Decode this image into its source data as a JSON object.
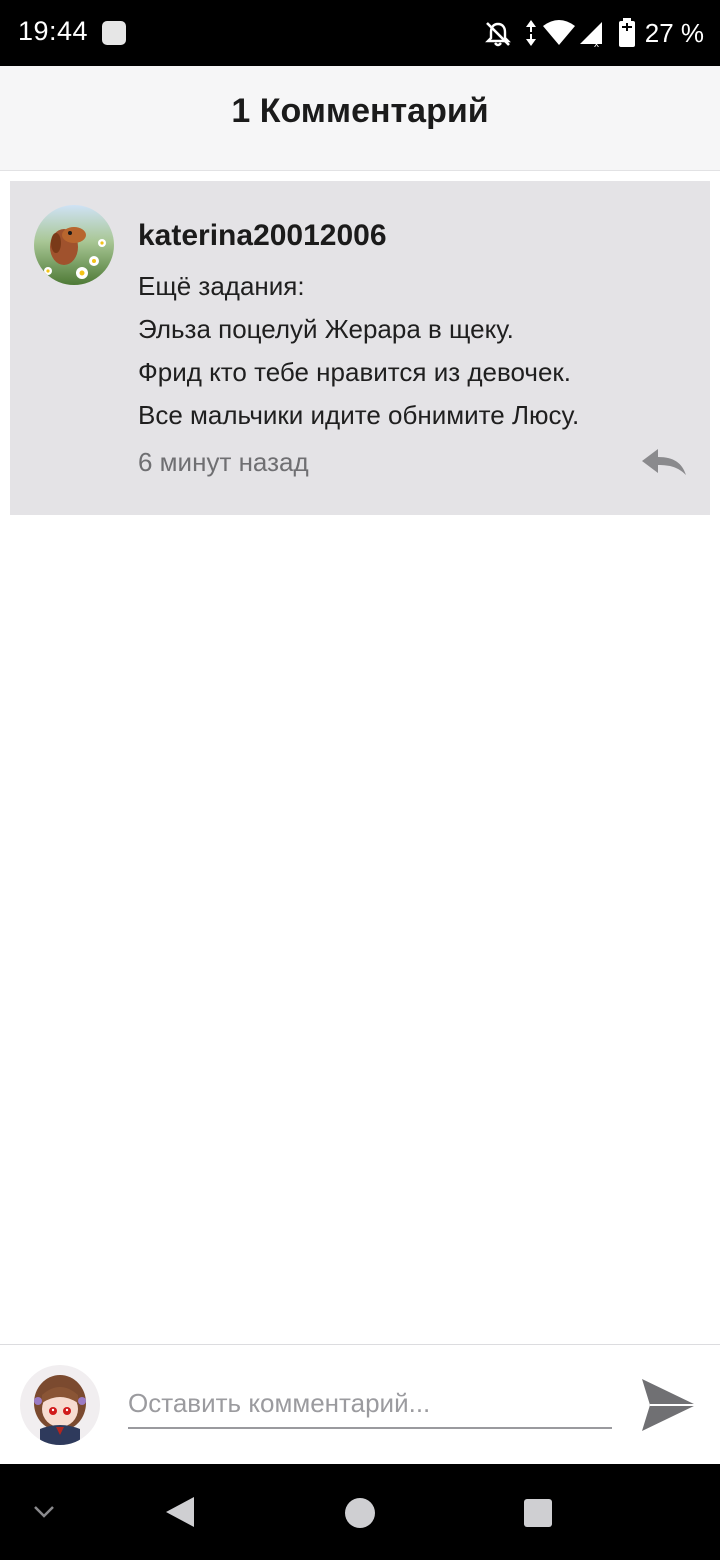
{
  "status_bar": {
    "time": "19:44",
    "battery_percent": "27 %",
    "icons": [
      "notification-square-icon",
      "bell-off-icon",
      "data-arrows-icon",
      "wifi-icon",
      "signal-icon",
      "battery-icon"
    ]
  },
  "header": {
    "title": "1 Комментарий"
  },
  "comments": [
    {
      "author": "katerina20012006",
      "lines": [
        "Ещё задания:",
        "Эльза поцелуй Жерара в щеку.",
        "Фрид кто тебе нравится из девочек.",
        "Все мальчики идите обнимите Люсу."
      ],
      "time": "6 минут назад",
      "avatar_icon": "dog-avatar"
    }
  ],
  "composer": {
    "placeholder": "Оставить комментарий...",
    "value": "",
    "avatar_icon": "anime-avatar",
    "send_icon": "send-icon"
  },
  "navigation": {
    "buttons": [
      "collapse-icon",
      "back-icon",
      "home-icon",
      "recents-icon"
    ]
  },
  "colors": {
    "header_bg": "#f6f6f7",
    "card_bg": "#e4e3e6",
    "muted_text": "#6f6f72",
    "icon_gray": "#7a7a7d"
  }
}
